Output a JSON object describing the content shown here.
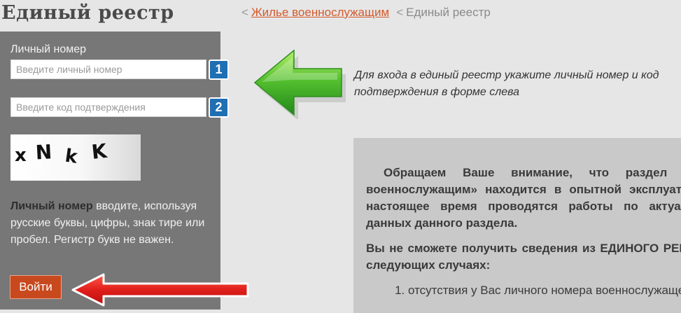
{
  "header": {
    "title": "Единый реестр",
    "breadcrumb": {
      "separator": "<",
      "link": "Жилье военнослужащим",
      "current": "Единый реестр"
    }
  },
  "sidebar": {
    "personal_number_label": "Личный номер",
    "personal_number_input": {
      "value": "",
      "placeholder": "Введите личный номер",
      "step": "1"
    },
    "confirm_input": {
      "value": "",
      "placeholder": "Введите код подтверждения",
      "step": "2"
    },
    "captcha_text": "xNkK",
    "hint_bold": "Личный номер",
    "hint_rest": " вводите, используя русские буквы, цифры, знак тире или пробел. Регистр букв не важен.",
    "login_button": "Войти"
  },
  "main": {
    "instruction": "Для входа в единый реестр укажите личный номер и код подтверждения в форме слева",
    "notice": {
      "paragraph1": "Обращаем Ваше внимание, что раздел «Жилье военнослужащим» находится в опытной эксплуатации. В настоящее время проводятся работы по актуализации данных данного раздела.",
      "paragraph2": "Вы не сможете получить сведения из ЕДИНОГО РЕЕСТРА в следующих случаях:",
      "item1": "отсутствия у Вас личного номера военнослужащего;"
    }
  },
  "colors": {
    "sidebar_bg": "#777777",
    "step_badge": "#1f6fb3",
    "login_button": "#c8491e",
    "link": "#d45a2c",
    "arrow_green": "#3aa12a",
    "arrow_red": "#e02020"
  },
  "icons": [
    "green-arrow-left-icon",
    "red-arrow-left-icon"
  ]
}
